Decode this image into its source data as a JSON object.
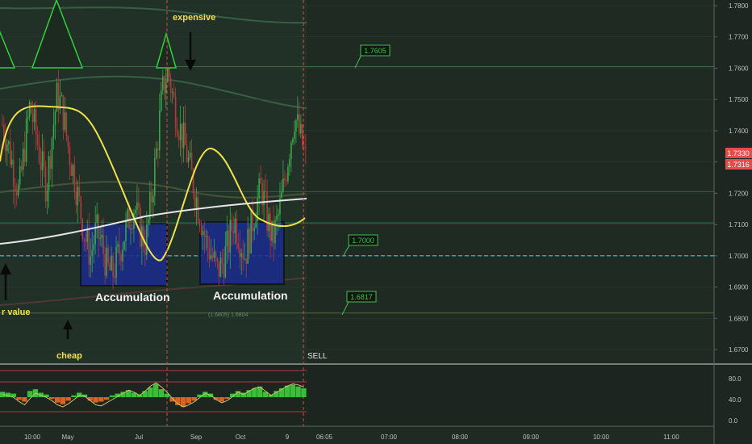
{
  "colors": {
    "background": "#1f2a23",
    "axis_text": "#b8c2bc",
    "candle_up": "#3aa64a",
    "candle_down": "#b23a3a",
    "mean_line": "#f0e14a",
    "ma_line": "#e6e6e6",
    "box_fill": "#1a2a8c",
    "price_tag": "#e84a4a",
    "annotation": "#f0e14a",
    "tag_text": "#3ec24e",
    "hist_pos": "#3bbf3b",
    "hist_neg": "#d8621e"
  },
  "annotations": {
    "expensive": "expensive",
    "cheap": "cheap",
    "fair_value": "r value",
    "accumulation_1": "Accumulation",
    "accumulation_2": "Accumulation",
    "sell": "SELL",
    "acc2_sub": "(1.6805) 1.6804"
  },
  "price_tags": {
    "current": "1.7330",
    "second": "1.7316"
  },
  "level_tags": [
    "1.7605",
    "1.7000",
    "1.6817"
  ],
  "chart_data": [
    {
      "type": "candlestick",
      "title": "",
      "ylim": [
        1.665,
        1.785
      ],
      "y_ticks": [
        "1.7800",
        "1.7700",
        "1.7600",
        "1.7500",
        "1.7400",
        "1.7300",
        "1.7200",
        "1.7100",
        "1.7000",
        "1.6900",
        "1.6800",
        "1.6700"
      ],
      "x_ticks": [
        "10:00",
        "May",
        "Jul",
        "Sep",
        "Oct",
        "9",
        "06:05",
        "07:00",
        "08:00",
        "09:00",
        "10:00",
        "11:00"
      ],
      "horizontal_levels": [
        1.7605,
        1.7,
        1.6817
      ],
      "price_path": [
        1.742,
        1.736,
        1.728,
        1.72,
        1.734,
        1.748,
        1.74,
        1.73,
        1.722,
        1.738,
        1.752,
        1.746,
        1.734,
        1.726,
        1.716,
        1.706,
        1.7,
        1.708,
        1.704,
        1.696,
        1.694,
        1.7,
        1.706,
        1.712,
        1.716,
        1.708,
        1.704,
        1.718,
        1.734,
        1.752,
        1.76,
        1.75,
        1.742,
        1.736,
        1.728,
        1.72,
        1.712,
        1.704,
        1.7,
        1.695,
        1.698,
        1.704,
        1.712,
        1.706,
        1.7,
        1.708,
        1.716,
        1.722,
        1.712,
        1.705,
        1.712,
        1.722,
        1.734,
        1.745,
        1.738,
        1.731
      ]
    },
    {
      "type": "bar",
      "title": "",
      "ylim": [
        0,
        90
      ],
      "y_ticks": [
        "80.0",
        "40.0",
        "0.0"
      ],
      "hist": [
        12,
        10,
        8,
        -6,
        -10,
        14,
        18,
        10,
        6,
        -4,
        -12,
        -16,
        -8,
        4,
        10,
        6,
        -8,
        -12,
        -10,
        -6,
        4,
        8,
        12,
        16,
        10,
        6,
        14,
        22,
        30,
        18,
        8,
        -10,
        -18,
        -22,
        -14,
        -8,
        6,
        12,
        8,
        -6,
        -10,
        -4,
        8,
        14,
        10,
        16,
        20,
        24,
        12,
        6,
        14,
        20,
        26,
        28,
        24,
        20
      ],
      "signal": [
        50,
        48,
        44,
        36,
        30,
        42,
        52,
        48,
        44,
        38,
        30,
        26,
        32,
        40,
        48,
        46,
        38,
        30,
        28,
        34,
        40,
        46,
        52,
        58,
        54,
        48,
        56,
        66,
        72,
        64,
        54,
        42,
        32,
        26,
        30,
        36,
        44,
        52,
        48,
        40,
        34,
        38,
        46,
        54,
        50,
        56,
        62,
        64,
        56,
        48,
        54,
        60,
        66,
        70,
        68,
        64
      ]
    }
  ]
}
